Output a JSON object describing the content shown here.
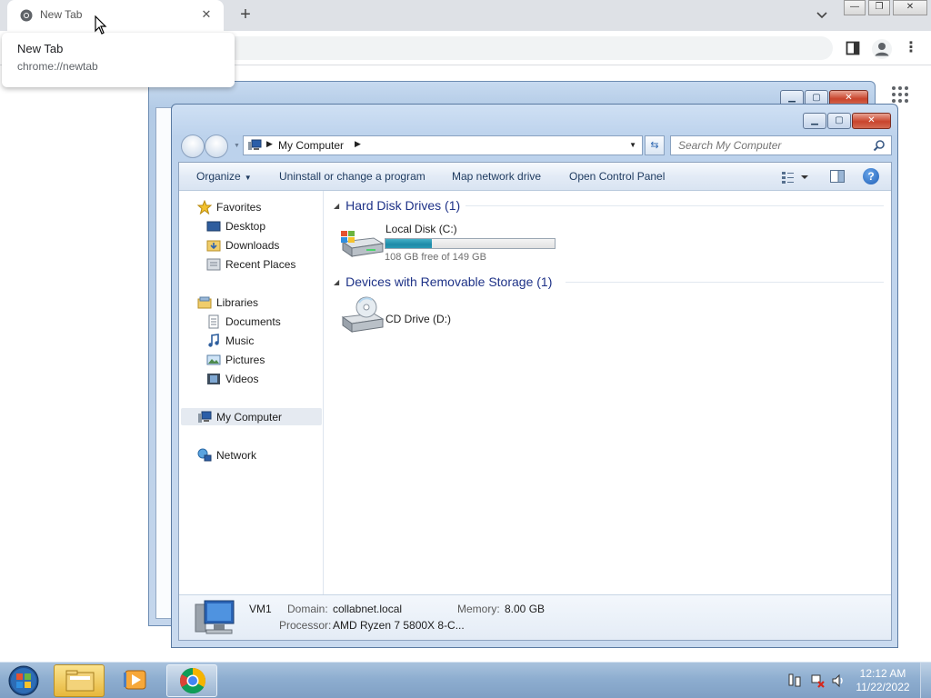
{
  "browser": {
    "tab_title": "New Tab",
    "tab_close": "✕",
    "new_tab": "+",
    "hovercard": {
      "title": "New Tab",
      "url": "chrome://newtab"
    }
  },
  "explorer": {
    "address_crumb": "My Computer",
    "search_placeholder": "Search My Computer",
    "commands": {
      "organize": "Organize",
      "uninstall": "Uninstall or change a program",
      "map_drive": "Map network drive",
      "control_panel": "Open Control Panel"
    },
    "nav": {
      "favorites": "Favorites",
      "desktop": "Desktop",
      "downloads": "Downloads",
      "recent_places": "Recent Places",
      "libraries": "Libraries",
      "documents": "Documents",
      "music": "Music",
      "pictures": "Pictures",
      "videos": "Videos",
      "my_computer": "My Computer",
      "network": "Network"
    },
    "groups": {
      "hard_disks": "Hard Disk Drives (1)",
      "removable": "Devices with Removable Storage (1)"
    },
    "drives": {
      "local": {
        "name": "Local Disk (C:)",
        "free_text": "108 GB free of 149 GB",
        "used_fraction": 0.275
      },
      "cd": {
        "name": "CD Drive (D:)"
      }
    },
    "details": {
      "computer_name": "VM1",
      "domain_label": "Domain:",
      "domain_value": "collabnet.local",
      "memory_label": "Memory:",
      "memory_value": "8.00 GB",
      "processor_label": "Processor:",
      "processor_value": "AMD Ryzen 7 5800X 8-C..."
    }
  },
  "taskbar": {
    "time": "12:12 AM",
    "date": "11/22/2022"
  },
  "colors": {
    "capacity_fill": "#1e8aa8",
    "group_header": "#1e3287",
    "taskbar": "#8eaed0"
  }
}
